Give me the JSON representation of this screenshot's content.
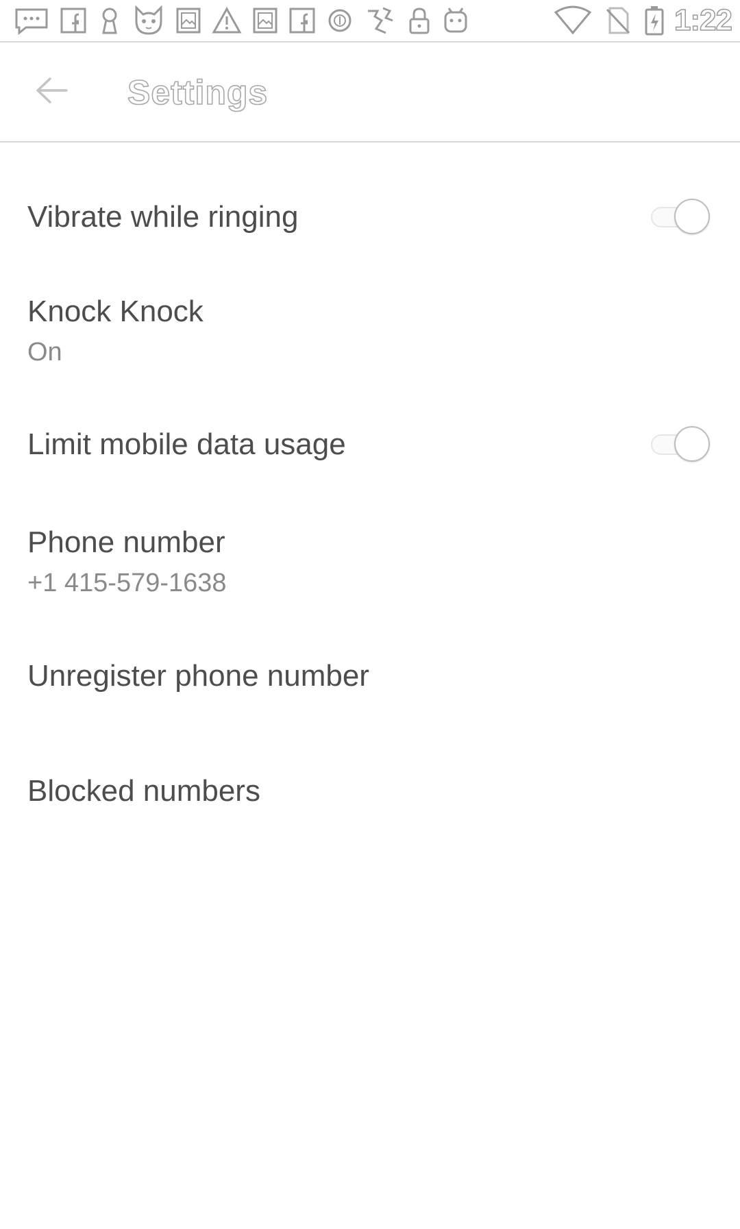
{
  "status_bar": {
    "left_icons": [
      "messenger-icon",
      "facebook-icon",
      "keyhole-icon",
      "cat-face-icon",
      "image-icon",
      "warning-icon",
      "image-icon",
      "facebook-icon",
      "circle-icon",
      "puzzle-icon",
      "lock-icon",
      "android-icon"
    ],
    "right_icons": [
      "wifi-icon",
      "no-sim-icon",
      "battery-charging-icon"
    ],
    "time": "1:22"
  },
  "toolbar": {
    "back_icon": "arrow-left-icon",
    "title": "Settings"
  },
  "settings": {
    "vibrate": {
      "title": "Vibrate while ringing",
      "enabled": false
    },
    "knock_knock": {
      "title": "Knock Knock",
      "summary": "On"
    },
    "limit_data": {
      "title": "Limit mobile data usage",
      "enabled": false
    },
    "phone_number": {
      "title": "Phone number",
      "summary": "+1 415-579-1638"
    },
    "unregister": {
      "title": "Unregister phone number"
    },
    "blocked": {
      "title": "Blocked numbers"
    }
  },
  "colors": {
    "text_primary": "#4d4d4d",
    "text_secondary": "#8a8a8a",
    "divider": "#d6d6d6",
    "background": "#ffffff"
  }
}
